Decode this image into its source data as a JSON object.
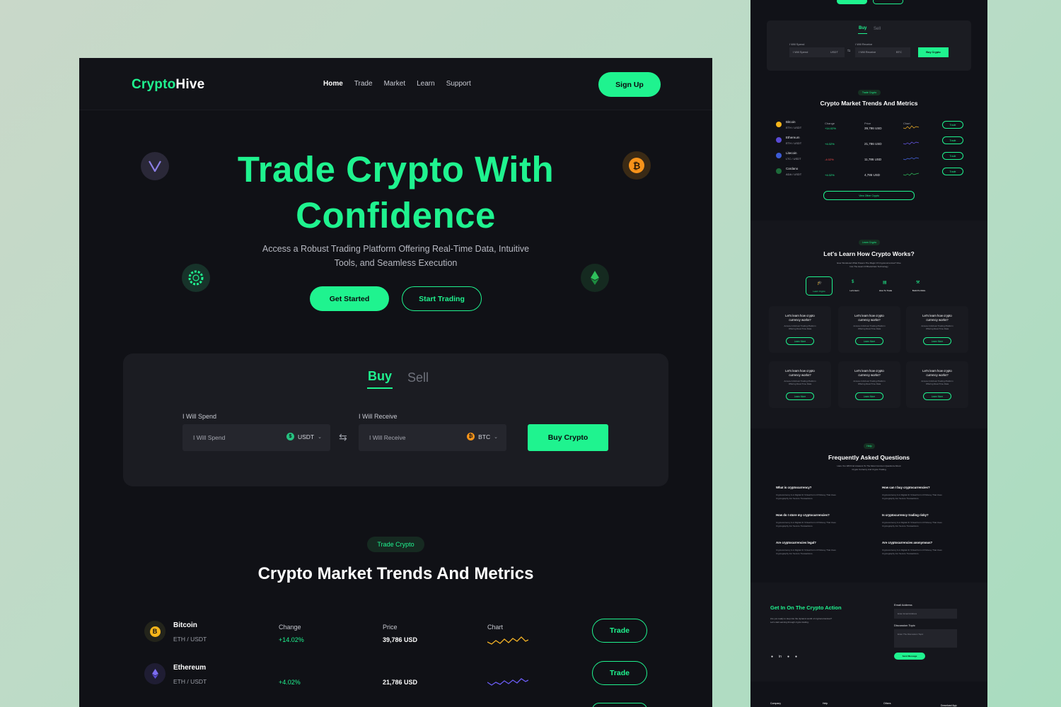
{
  "main": {
    "logo": {
      "part1": "Crypto",
      "part2": "Hive"
    },
    "nav": [
      "Home",
      "Trade",
      "Market",
      "Learn",
      "Support"
    ],
    "signup": "Sign Up",
    "hero": {
      "title_line1": "Trade Crypto With",
      "title_line2": "Confidence",
      "subtitle_line1": "Access a Robust Trading Platform Offering Real-Time Data, Intuitive",
      "subtitle_line2": "Tools, and Seamless Execution",
      "get_started": "Get Started",
      "start_trading": "Start Trading"
    },
    "exchange": {
      "tab_buy": "Buy",
      "tab_sell": "Sell",
      "spend_label": "I Will Spend",
      "spend_placeholder": "I Will Spend",
      "spend_currency": "USDT",
      "receive_label": "I Will Receive",
      "receive_placeholder": "I Will Receive",
      "receive_currency": "BTC",
      "buy_button": "Buy Crypto"
    },
    "market": {
      "tag": "Trade Crypto",
      "title": "Crypto Market Trends And Metrics",
      "col_change": "Change",
      "col_price": "Price",
      "col_chart": "Chart",
      "rows": [
        {
          "name": "Bitcoin",
          "pair": "ETH / USDT",
          "change": "+14.02%",
          "price": "39,786 USD",
          "trade": "Trade"
        },
        {
          "name": "Ethereum",
          "pair": "ETH / USDT",
          "change": "+4.02%",
          "price": "21,786 USD",
          "trade": "Trade"
        }
      ]
    }
  },
  "side": {
    "exchange": {
      "tab_buy": "Buy",
      "tab_sell": "Sell",
      "spend_label": "I Will Spend",
      "receive_label": "I Will Receive",
      "spend_ph": "I Will Spend",
      "receive_ph": "I Will Receive",
      "spend_cur": "USDT",
      "receive_cur": "BTC",
      "buy": "Buy Crypto"
    },
    "market": {
      "tag": "Trade Crypto",
      "title": "Crypto Market Trends And Metrics",
      "col_change": "Change",
      "col_price": "Price",
      "col_chart": "Chart",
      "rows": [
        {
          "name": "Bitcoin",
          "pair": "ETH / USDT",
          "change": "+14.02%",
          "price": "39,786 USD",
          "trade": "Trade"
        },
        {
          "name": "Ethereum",
          "pair": "ETH / USDT",
          "change": "+4.02%",
          "price": "21,786 USD",
          "trade": "Trade"
        },
        {
          "name": "Litecoin",
          "pair": "LTC / USDT",
          "change": "-4.02%",
          "price": "11,786 USD",
          "trade": "Trade"
        },
        {
          "name": "Cardano",
          "pair": "ADA / USDT",
          "change": "+4.02%",
          "price": "4,786 USD",
          "trade": "Trade"
        }
      ],
      "view_other": "View Other Crypto"
    },
    "learn": {
      "tag": "Learn Crypto",
      "title": "Let's Learn How Crypto Works?",
      "subtitle_line1": "Ever Wondered What Powers The Magic Of Cryptocurrencies? Dive",
      "subtitle_line2": "Into The Heart Of Blockchain Technology",
      "tabs": [
        "Learn Crypto",
        "Let's Earn",
        "How To Trade",
        "Build Portfolio"
      ],
      "card_title_line1": "Let's learn how crypto",
      "card_title_line2": "currency works?",
      "card_desc_line1": "Access A Robust Trading Platform",
      "card_desc_line2": "Offering Real-Time Data",
      "card_btn": "Learn More"
    },
    "faq": {
      "tag": "Help",
      "title": "Frequently Asked Questions",
      "subtitle_line1": "Here You Will Find Answers To The Most Common Questions About",
      "subtitle_line2": "Crypto Currency And Crypto Trading",
      "answer_line1": "Cryptocurrency Is A Digital Or Virtual Form Of Money That Uses",
      "answer_line2": "Cryptography For Secure Transactions.",
      "questions": [
        "What is cryptocurrency?",
        "How can I buy cryptocurrencies?",
        "How do I store my cryptocurrencies?",
        "Is cryptocurrency trading risky?",
        "Are cryptocurrencies legal?",
        "Are cryptocurrencies anonymous?"
      ]
    },
    "contact": {
      "title": "Get In On The Crypto Action",
      "desc_line1": "Are you ready to step into the dynamic world of cryptocurrencies?",
      "desc_line2": "Let's start earning through crypto trading.",
      "email_label": "Email Address",
      "email_ph": "Enter Email Address",
      "topic_label": "Discussion Topic",
      "topic_ph": "Enter The Discussion Topic",
      "send": "Send Message"
    },
    "footer": {
      "cols": [
        "Company",
        "Help",
        "Others",
        "Download App"
      ]
    }
  },
  "colors": {
    "accent": "#1ff38f",
    "bg": "#101116",
    "card": "#1b1c22"
  }
}
